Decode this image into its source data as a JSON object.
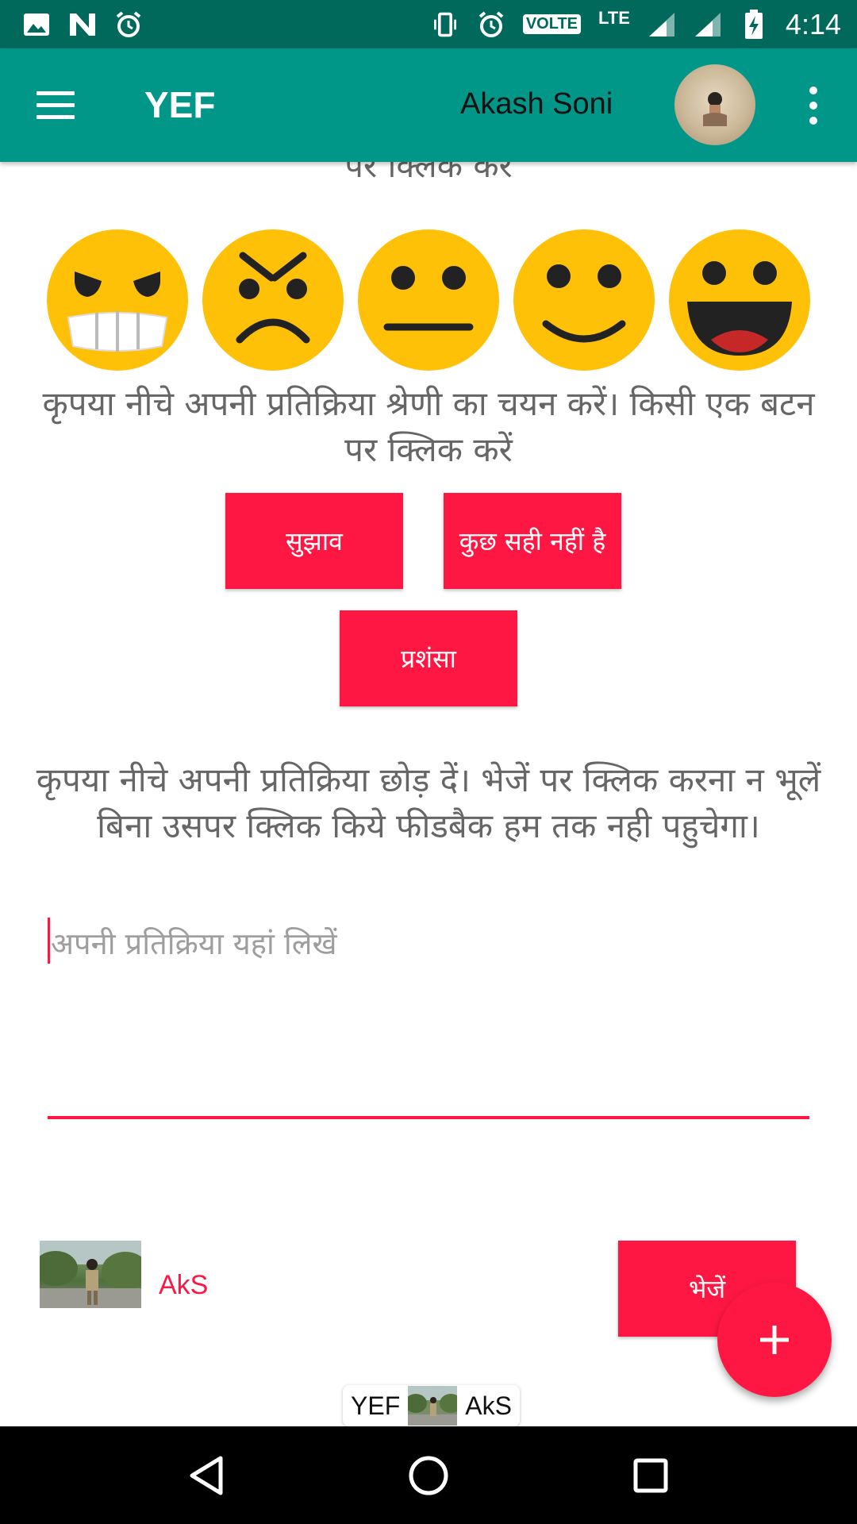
{
  "status_bar": {
    "volte_label": "VOLTE",
    "lte_label": "LTE",
    "time": "4:14"
  },
  "app_bar": {
    "title": "YEF",
    "user_name": "Akash Soni"
  },
  "content": {
    "cut_off_text": "पर क्लिक करें",
    "emojis": [
      "angry-emoji",
      "sad-emoji",
      "neutral-emoji",
      "happy-emoji",
      "very-happy-emoji"
    ],
    "category_instruction": "कृपया नीचे अपनी प्रतिक्रिया श्रेणी का चयन करें। किसी एक बटन पर क्लिक करें",
    "categories": {
      "suggestion": "सुझाव",
      "something_wrong": "कुछ सही नहीं है",
      "praise": "प्रशंसा"
    },
    "feedback_instruction": "कृपया नीचे अपनी प्रतिक्रिया छोड़ दें। भेजें पर क्लिक करना न भूलें  बिना उसपर क्लिक किये फीडबैक हम तक नही पहुचेगा।",
    "feedback_placeholder": "अपनी प्रतिक्रिया यहां लिखें",
    "signature_name": "AkS",
    "send_label": "भेजें"
  },
  "footer": {
    "app_name": "YEF",
    "author": "AkS"
  },
  "colors": {
    "status_bar": "#00695c",
    "app_bar": "#009688",
    "accent": "#ff1744",
    "emoji_yellow": "#ffc107"
  }
}
